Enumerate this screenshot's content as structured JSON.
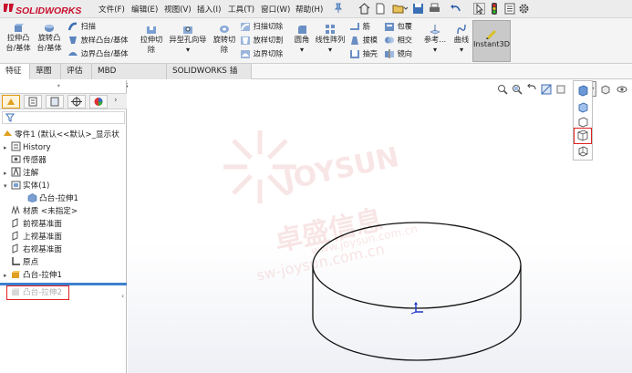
{
  "app": {
    "logo": "SOLIDWORKS"
  },
  "menu": [
    "文件(F)",
    "编辑(E)",
    "视图(V)",
    "插入(I)",
    "工具(T)",
    "窗口(W)",
    "帮助(H)"
  ],
  "ribbon": {
    "extrude_boss": [
      "拉伸凸",
      "台/基体"
    ],
    "revolve_boss": [
      "旋转凸",
      "台/基体"
    ],
    "sweep": "扫描",
    "loft": "放样凸台/基体",
    "boundary_boss": "边界凸台/基体",
    "extrude_cut": [
      "拉伸切",
      "除"
    ],
    "hole_wizard": [
      "异型孔向导"
    ],
    "revolve_cut": [
      "旋转切",
      "除"
    ],
    "sweep_cut": "扫描切除",
    "loft_cut": "放样切割",
    "boundary_cut": "边界切除",
    "fillet": "圆角",
    "linear_pattern": "线性阵列",
    "rib": "筋",
    "draft": "拔模",
    "shell": "抽壳",
    "wrap": "包覆",
    "intersect": "相交",
    "mirror": "镜向",
    "ref_geometry": "参考...",
    "curves": "曲线",
    "instant3d": "Instant3D"
  },
  "tabs": [
    "特征",
    "草图",
    "评估",
    "MBD Dimensions",
    "SOLIDWORKS 插件"
  ],
  "tree": {
    "root": "零件1 (默认<<默认>_显示状",
    "items": [
      {
        "label": "History",
        "expand": "▸",
        "indent": 0
      },
      {
        "label": "传感器",
        "expand": "",
        "indent": 0
      },
      {
        "label": "注解",
        "expand": "▸",
        "indent": 0
      },
      {
        "label": "实体(1)",
        "expand": "▾",
        "indent": 0
      },
      {
        "label": "凸台-拉伸1",
        "expand": "",
        "indent": 1
      },
      {
        "label": "材质 <未指定>",
        "expand": "",
        "indent": 0
      },
      {
        "label": "前视基准面",
        "expand": "",
        "indent": 0
      },
      {
        "label": "上视基准面",
        "expand": "",
        "indent": 0
      },
      {
        "label": "右视基准面",
        "expand": "",
        "indent": 0
      },
      {
        "label": "原点",
        "expand": "",
        "indent": 0
      },
      {
        "label": "凸台-拉伸1",
        "expand": "▸",
        "indent": 0
      },
      {
        "label": "凸台-拉伸2",
        "expand": "",
        "indent": 0
      }
    ]
  },
  "watermark": {
    "brand": "JOYSUN",
    "cn": "卓盛信息",
    "url1": "www.joysun.com.cn",
    "url2": "sw-joysun.com.cn"
  },
  "colors": {
    "accent_red": "#e02020",
    "highlight_blue": "#3d7fcf"
  }
}
